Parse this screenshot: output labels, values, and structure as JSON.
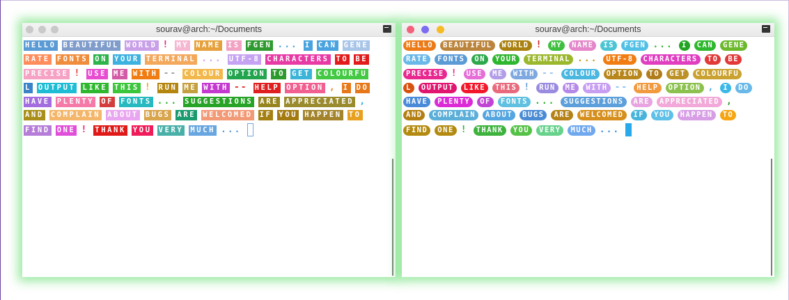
{
  "windows": [
    {
      "title": "sourav@arch:~/Documents",
      "style": "square",
      "buttons": [
        "#c9c9c9",
        "#c9c9c9",
        "#c9c9c9"
      ],
      "lines": [
        [
          [
            "HELLO",
            "#5b9bd5"
          ],
          [
            "BEAUTIFUL",
            "#7f9ccb"
          ],
          [
            "WORLD",
            "#c9a0e8"
          ],
          [
            "!",
            "#e91e8c",
            "p"
          ],
          [
            "MY",
            "#f5b7d1"
          ],
          [
            "NAME",
            "#e6a13c"
          ],
          [
            "IS",
            "#f2a2c2"
          ],
          [
            "FGEN",
            "#2f9a2f"
          ],
          [
            "...",
            "#4aa3df",
            "p"
          ],
          [
            "I",
            "#4aa3df"
          ],
          [
            "CAN",
            "#4aa3df"
          ],
          [
            "GENE",
            "#a8c5e8"
          ]
        ],
        [
          [
            "RATE",
            "#ff8c5a"
          ],
          [
            "FONTS",
            "#f08d3c"
          ],
          [
            "ON",
            "#2db34a"
          ],
          [
            "YOUR",
            "#3db1e0"
          ],
          [
            "TERMINAL",
            "#f3a85c"
          ],
          [
            "...",
            "#d9a0f0",
            "p"
          ],
          [
            "UTF-8",
            "#c5a3f2"
          ],
          [
            "CHARACTERS",
            "#e83aa5"
          ],
          [
            "TO",
            "#e31a1a"
          ],
          [
            "BE",
            "#e31a1a"
          ]
        ],
        [
          [
            "PRECISE",
            "#f6a2c4"
          ],
          [
            "!",
            "#e83a3a",
            "p"
          ],
          [
            "USE",
            "#e84cd1"
          ],
          [
            "ME",
            "#d35aa5"
          ],
          [
            "WITH",
            "#f07c12"
          ],
          [
            "--",
            "#a0a0a0",
            "p"
          ],
          [
            "COLOUR",
            "#f2b84b"
          ],
          [
            "OPTION",
            "#23a54e"
          ],
          [
            "TO",
            "#2d9a2d"
          ],
          [
            "GET",
            "#3cb4d8"
          ],
          [
            "COLOURFU",
            "#44c944"
          ]
        ],
        [
          [
            "L",
            "#3b83c8"
          ],
          [
            "OUTPUT",
            "#1fbcd6"
          ],
          [
            "LIKE",
            "#2fb82f"
          ],
          [
            "THIS",
            "#3cc63c"
          ],
          [
            "!",
            "#f7a41d",
            "p"
          ],
          [
            "RUN",
            "#b5860f"
          ],
          [
            "ME",
            "#c5a040"
          ],
          [
            "WITH",
            "#c43ad0"
          ],
          [
            "--",
            "#e53030",
            "p"
          ],
          [
            "HELP",
            "#e02020"
          ],
          [
            "OPTION",
            "#f06090"
          ],
          [
            ",",
            "#f08a30",
            "p"
          ],
          [
            "I",
            "#e6781a"
          ],
          [
            "DO",
            "#e6781a"
          ]
        ],
        [
          [
            "HAVE",
            "#a36de0"
          ],
          [
            "PLENTY",
            "#f57aa8"
          ],
          [
            "OF",
            "#d33d3d"
          ],
          [
            "FONTS",
            "#27b9c0"
          ],
          [
            "...",
            "#2fb62f",
            "p"
          ],
          [
            "SUGGESTIONS",
            "#27a327"
          ],
          [
            "ARE",
            "#96851f"
          ],
          [
            "APPRECIATED",
            "#9a8b2e"
          ],
          [
            ",",
            "#38b0e8",
            "p"
          ]
        ],
        [
          [
            "AND",
            "#a98f1a"
          ],
          [
            "COMPLAIN",
            "#f4b66a"
          ],
          [
            "ABOUT",
            "#e9a6f0"
          ],
          [
            "BUGS",
            "#d8a44c"
          ],
          [
            "ARE",
            "#1b9a6f"
          ],
          [
            "WELCOMED",
            "#f29a76"
          ],
          [
            "IF",
            "#a47f12"
          ],
          [
            "YOU",
            "#a37a0f"
          ],
          [
            "HAPPEN",
            "#a3842c"
          ],
          [
            "TO",
            "#e8a020"
          ]
        ],
        [
          [
            "FIND",
            "#b57cd8"
          ],
          [
            "ONE",
            "#e14ed9"
          ],
          [
            "!",
            "#e8206a",
            "p"
          ],
          [
            "THANK",
            "#e01818"
          ],
          [
            "YOU",
            "#f01c5a"
          ],
          [
            "VERY",
            "#48b0a8"
          ],
          [
            "MUCH",
            "#67a6e0"
          ],
          [
            "...",
            "#5b9bd5",
            "p"
          ],
          [
            "",
            "cursor",
            "c"
          ]
        ]
      ]
    },
    {
      "title": "sourav@arch:~/Documents",
      "style": "round",
      "buttons": [
        "#f3617b",
        "#7b6cf3",
        "#f6bb24"
      ],
      "lines": [
        [
          [
            "HELLO",
            "#ec7a17"
          ],
          [
            "BEAUTIFUL",
            "#bb843c"
          ],
          [
            "WORLD",
            "#a98110"
          ],
          [
            "!",
            "#d41e1e",
            "p"
          ],
          [
            "MY",
            "#3fbf3f"
          ],
          [
            "NAME",
            "#e486c9"
          ],
          [
            "IS",
            "#4cc4d4"
          ],
          [
            "FGEN",
            "#52c0e6"
          ],
          [
            "...",
            "#2db52d",
            "p"
          ],
          [
            "I",
            "#22a522"
          ],
          [
            "CAN",
            "#2db82d"
          ],
          [
            "GENE",
            "#6cb82c"
          ]
        ],
        [
          [
            "RATE",
            "#69b8e8"
          ],
          [
            "FONTS",
            "#5b9bd5"
          ],
          [
            "ON",
            "#2ca84a"
          ],
          [
            "YOUR",
            "#2fb62f"
          ],
          [
            "TERMINAL",
            "#9bb72c"
          ],
          [
            "...",
            "#c29a1a",
            "p"
          ],
          [
            "UTF-8",
            "#f07c12"
          ],
          [
            "CHARACTERS",
            "#e03ec1"
          ],
          [
            "TO",
            "#e13838"
          ],
          [
            "BE",
            "#e23838"
          ]
        ],
        [
          [
            "PRECISE",
            "#e8288f"
          ],
          [
            "!",
            "#e8288f",
            "p"
          ],
          [
            "USE",
            "#e56ed7"
          ],
          [
            "ME",
            "#b29ee8"
          ],
          [
            "WITH",
            "#7ea8e0"
          ],
          [
            "--",
            "#9cc4e8",
            "p"
          ],
          [
            "COLOUR",
            "#4ab7e0"
          ],
          [
            "OPTION",
            "#b8871c"
          ],
          [
            "TO",
            "#b07d1a"
          ],
          [
            "GET",
            "#bc9226"
          ],
          [
            "COLOURFU",
            "#caa231"
          ]
        ],
        [
          [
            "L",
            "#d8520f"
          ],
          [
            "OUTPUT",
            "#e1146f"
          ],
          [
            "LIKE",
            "#f2182a"
          ],
          [
            "THIS",
            "#e86a7c"
          ],
          [
            "!",
            "#6a9fda",
            "p"
          ],
          [
            "RUN",
            "#9a8ae0"
          ],
          [
            "ME",
            "#b589e8"
          ],
          [
            "WITH",
            "#c79ef2"
          ],
          [
            "--",
            "#89c3f2",
            "p"
          ],
          [
            "HELP",
            "#f29a3f"
          ],
          [
            "OPTION",
            "#8cc14f"
          ],
          [
            ",",
            "#48b0e0",
            "p"
          ],
          [
            "I",
            "#3ab8e8"
          ],
          [
            "DO",
            "#69b8e8"
          ]
        ],
        [
          [
            "HAVE",
            "#4a8ad8"
          ],
          [
            "PLENTY",
            "#dc2ad6"
          ],
          [
            "OF",
            "#c045d4"
          ],
          [
            "FONTS",
            "#5fc0e0"
          ],
          [
            "...",
            "#28b428",
            "p"
          ],
          [
            "SUGGESTIONS",
            "#5c9fda"
          ],
          [
            "ARE",
            "#e7a4e0"
          ],
          [
            "APPRECIATED",
            "#f2a8d8"
          ],
          [
            ",",
            "#2d9a2d",
            "p"
          ]
        ],
        [
          [
            "AND",
            "#b37f12"
          ],
          [
            "COMPLAIN",
            "#5baed8"
          ],
          [
            "ABOUT",
            "#54a5e0"
          ],
          [
            "BUGS",
            "#4a8bd4"
          ],
          [
            "ARE",
            "#b48216"
          ],
          [
            "WELCOMED",
            "#d68f1c"
          ],
          [
            "IF",
            "#47b4dc"
          ],
          [
            "YOU",
            "#5fc0e8"
          ],
          [
            "HAPPEN",
            "#d79ee6"
          ],
          [
            "TO",
            "#f5a612"
          ]
        ],
        [
          [
            "FIND",
            "#b38a0f"
          ],
          [
            "ONE",
            "#b38a0f"
          ],
          [
            "!",
            "#2fb62f",
            "p"
          ],
          [
            "THANK",
            "#3db33d"
          ],
          [
            "YOU",
            "#55c247"
          ],
          [
            "VERY",
            "#67d28c"
          ],
          [
            "MUCH",
            "#6fa8ee"
          ],
          [
            "...",
            "#3a8fd8",
            "p"
          ],
          [
            "",
            "cursor",
            "c"
          ]
        ]
      ]
    }
  ]
}
